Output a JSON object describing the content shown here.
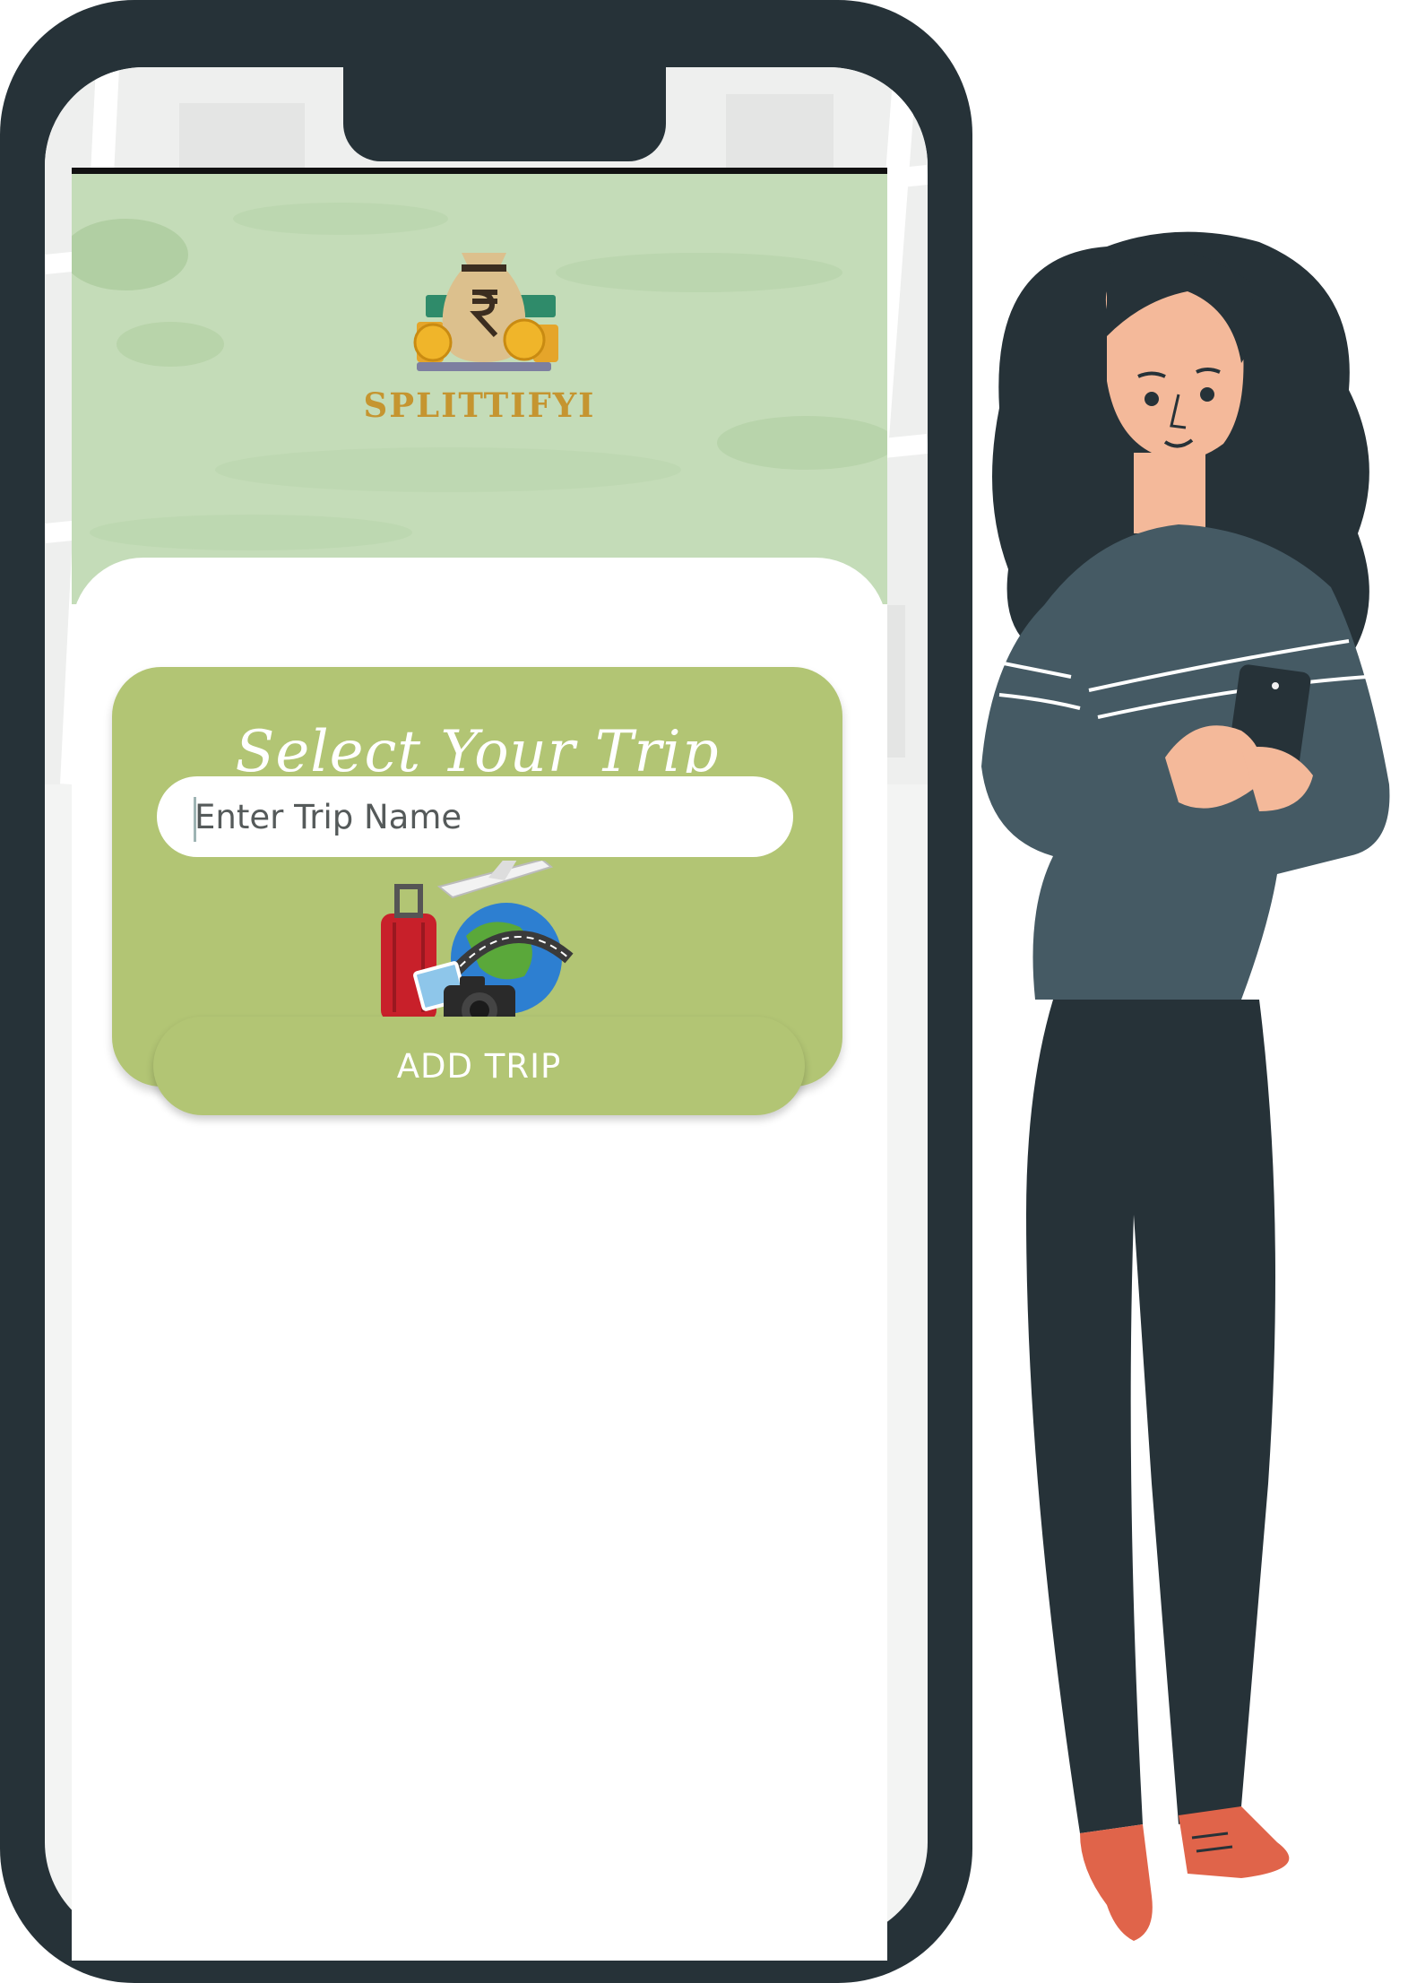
{
  "app": {
    "brand_name": "SPLITTIFYI",
    "card_title": "Select Your Trip",
    "input_placeholder": "Enter Trip Name",
    "add_button_label": "ADD TRIP"
  },
  "colors": {
    "accent_green": "#b2c574",
    "hero_green": "#c4dcb8",
    "brand_gold": "#c59530",
    "phone_frame": "#263238"
  },
  "icons": [
    "money-bag-icon",
    "rupee-icon",
    "suitcase-icon",
    "airplane-icon",
    "globe-icon",
    "camera-icon",
    "smartphone-icon"
  ]
}
